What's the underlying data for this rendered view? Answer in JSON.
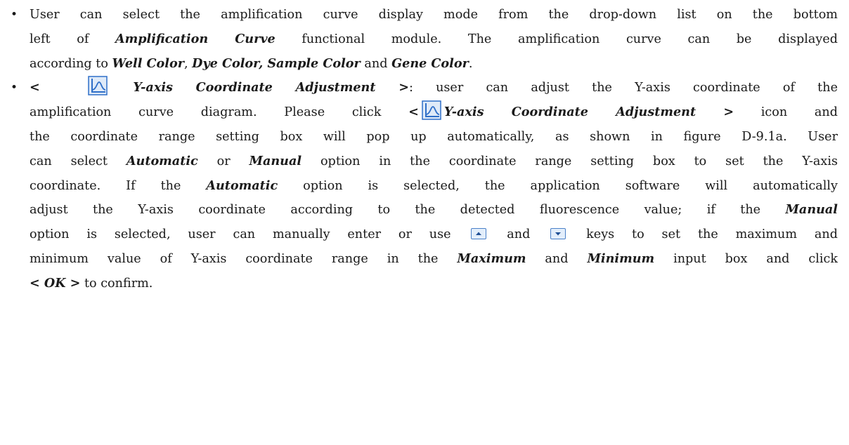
{
  "bullet1": {
    "line1": "User can select the amplification curve display mode from the drop-down list on the bottom",
    "line2_a": "left of ",
    "line2_b": "Amplification Curve",
    "line2_c": " functional module. The amplification curve can be displayed",
    "line3_a": "according to ",
    "line3_b": "Well Color",
    "line3_c": ", ",
    "line3_d": "Dye Color, Sample Color",
    "line3_e": " and ",
    "line3_f": "Gene Color",
    "line3_g": "."
  },
  "bullet2": {
    "lt1": "<",
    "title1": "Y-axis Coordinate Adjustment >",
    "line1_rest": ": user can adjust the Y-axis coordinate of the",
    "line2_a": "amplification curve diagram. Please click ",
    "lt2": "<",
    "title2": "Y-axis Coordinate Adjustment >",
    "line2_b": " icon and",
    "line3": "the coordinate range setting box will pop up automatically, as shown in figure D-9.1a. User",
    "line4_a": "can select ",
    "automatic1": "Automatic",
    "line4_b": " or ",
    "manual1": "Manual",
    "line4_c": " option in the coordinate range setting box to set the Y-axis",
    "line5_a": "coordinate. If the ",
    "automatic2": "Automatic",
    "line5_b": " option is selected, the application software will automatically",
    "line6_a": "adjust the Y-axis coordinate according to the detected fluorescence value; if the ",
    "manual2": "Manual",
    "line7_a": "option is selected, user can manually enter or use ",
    "line7_b": " and ",
    "line7_c": " keys to set the maximum and",
    "line8_a": "minimum value of Y-axis coordinate range in the ",
    "maximum": "Maximum",
    "line8_b": " and ",
    "minimum": "Minimum",
    "line8_c": " input box and click",
    "ok": "< OK >",
    "line9_rest": " to confirm."
  },
  "icons": {
    "bullet": "bullet-dot",
    "y_axis_adjust": "y-axis-coordinate-adjustment-icon",
    "spin_up": "spin-up-key-icon",
    "spin_down": "spin-down-key-icon"
  },
  "colors": {
    "icon_blue": "#2f6fc8",
    "icon_bg": "#dfeaf8"
  }
}
